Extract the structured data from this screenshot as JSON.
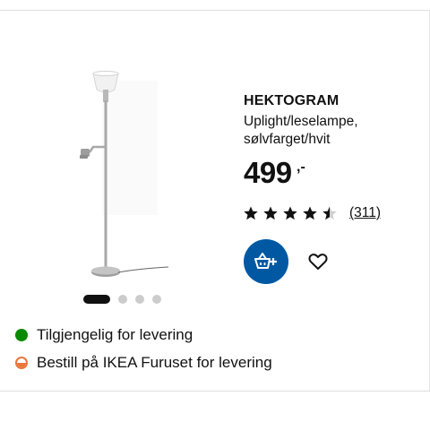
{
  "product": {
    "name": "HEKTOGRAM",
    "description": "Uplight/leselampe, sølvfarget/hvit",
    "price": "499",
    "price_suffix": ",-",
    "rating": 4.5,
    "review_count": "(311)"
  },
  "carousel": {
    "total": 4,
    "active_index": 0
  },
  "availability": [
    {
      "text": "Tilgjengelig for levering",
      "status": "available",
      "color": "#0a8a00"
    },
    {
      "text": "Bestill på IKEA Furuset for levering",
      "status": "order",
      "color": "#e8773a"
    }
  ],
  "colors": {
    "accent": "#0058a3",
    "text": "#111111"
  },
  "icons": {
    "cart": "add-to-cart-icon",
    "favourite": "heart-icon",
    "star": "star-icon"
  }
}
